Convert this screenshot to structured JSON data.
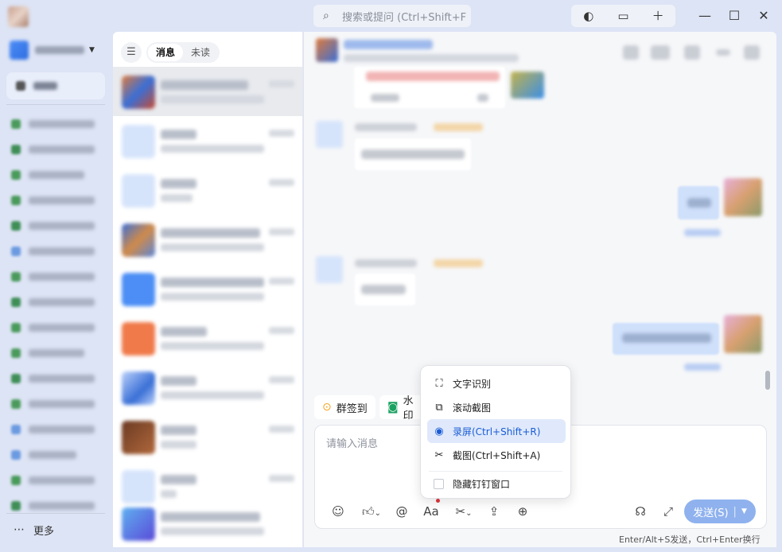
{
  "titlebar": {
    "search_placeholder": "搜索或提问 (Ctrl+Shift+F",
    "tools": [
      "moon-icon",
      "monitor-icon",
      "plus-icon"
    ],
    "window_controls": [
      "minimize",
      "maximize",
      "close"
    ]
  },
  "sidebar": {
    "more_label": "更多"
  },
  "conversation_list": {
    "tabs": [
      {
        "label": "消息",
        "active": true
      },
      {
        "label": "未读",
        "active": false
      }
    ]
  },
  "chat": {
    "quick_actions": [
      {
        "label": "群签到",
        "icon": "location-pin-icon",
        "color": "#f5a623"
      },
      {
        "label": "水印",
        "icon": "camera-icon",
        "color": "#1aa260"
      }
    ],
    "input_placeholder": "请输入消息",
    "send_label": "发送(S)",
    "hint": "Enter/Alt+S发送，Ctrl+Enter换行"
  },
  "screenshot_menu": {
    "items": [
      {
        "label": "文字识别",
        "icon": "text-recognition-icon",
        "selected": false
      },
      {
        "label": "滚动截图",
        "icon": "scroll-capture-icon",
        "selected": false
      },
      {
        "label": "录屏(Ctrl+Shift+R)",
        "icon": "record-icon",
        "selected": true
      },
      {
        "label": "截图(Ctrl+Shift+A)",
        "icon": "scissors-icon",
        "selected": false
      },
      {
        "label": "隐藏钉钉窗口",
        "icon": "checkbox",
        "selected": false
      }
    ]
  },
  "colors": {
    "accent": "#2e6de0",
    "send_button": "#8fb2ee",
    "background": "#dde4f5"
  }
}
